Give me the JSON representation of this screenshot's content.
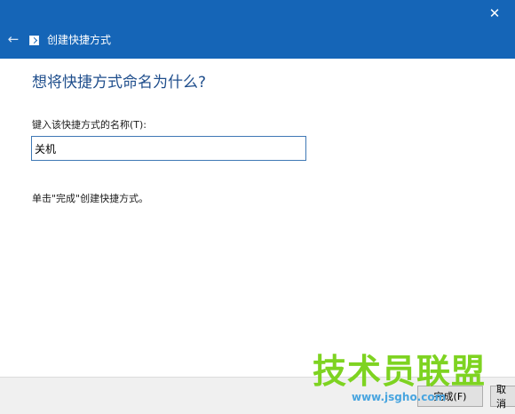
{
  "titlebar": {
    "close_glyph": "✕",
    "back_glyph": "←",
    "wizard_title": "创建快捷方式",
    "accent_color": "#1565b7"
  },
  "main": {
    "heading": "想将快捷方式命名为什么?",
    "name_label": "键入该快捷方式的名称(T):",
    "name_value": "关机",
    "instruction": "单击\"完成\"创建快捷方式。"
  },
  "footer": {
    "finish_label": "完成(F)",
    "cancel_label": "取消"
  },
  "watermark": {
    "text": "技术员联盟",
    "url": "www.jsgho.com"
  }
}
